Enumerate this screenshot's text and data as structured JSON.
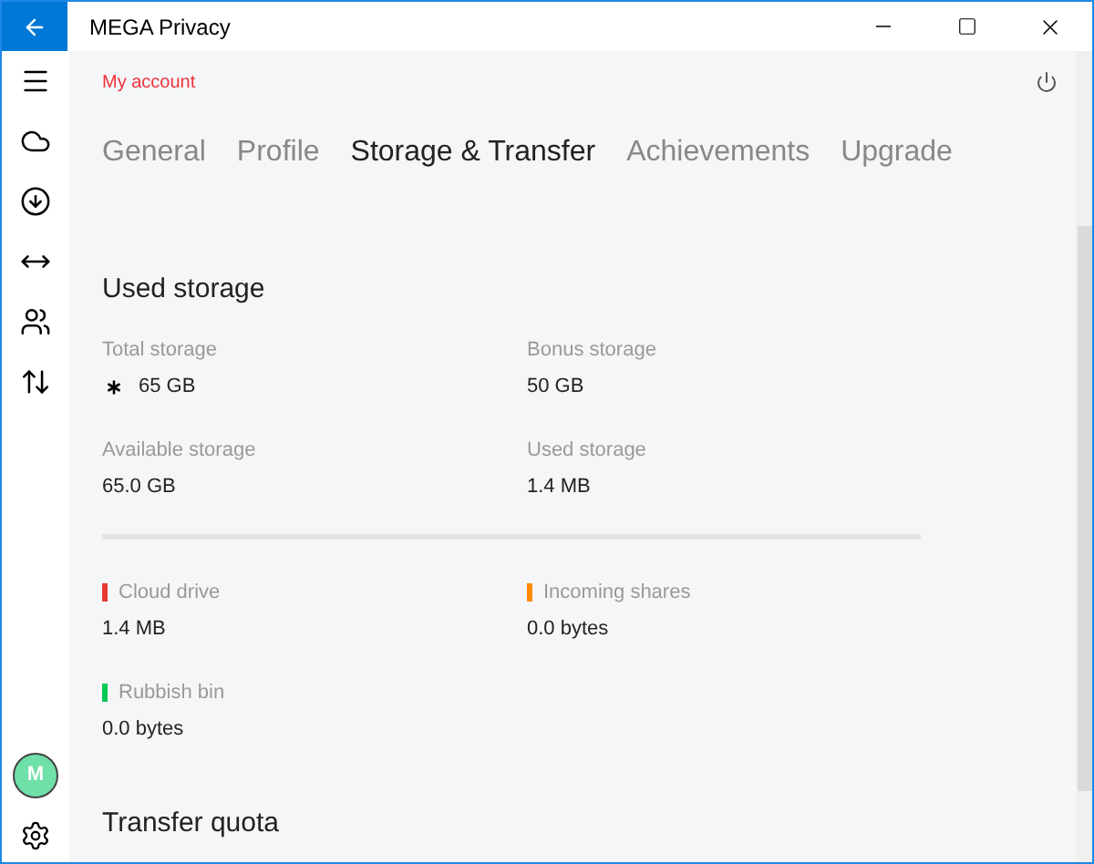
{
  "window": {
    "title": "MEGA Privacy"
  },
  "sidebar": {
    "items": [
      {
        "kind": "menu"
      },
      {
        "kind": "cloud"
      },
      {
        "kind": "download"
      },
      {
        "kind": "transfer"
      },
      {
        "kind": "contacts"
      },
      {
        "kind": "updown"
      }
    ],
    "avatar": "M"
  },
  "header": {
    "breadcrumb": "My account"
  },
  "tabs": [
    {
      "label": "General",
      "selected": false
    },
    {
      "label": "Profile",
      "selected": false
    },
    {
      "label": "Storage & Transfer",
      "selected": true
    },
    {
      "label": "Achievements",
      "selected": false
    },
    {
      "label": "Upgrade",
      "selected": false
    }
  ],
  "used_storage": {
    "title": "Used storage",
    "stats": [
      {
        "label": "Total storage",
        "value": "65 GB",
        "asterisk": true
      },
      {
        "label": "Bonus storage",
        "value": "50 GB",
        "asterisk": false
      },
      {
        "label": "Available storage",
        "value": "65.0 GB",
        "asterisk": false
      },
      {
        "label": "Used storage",
        "value": "1.4 MB",
        "asterisk": false
      }
    ],
    "breakdown": [
      {
        "label": "Cloud drive",
        "value": "1.4 MB",
        "color": "#e53935"
      },
      {
        "label": "Incoming shares",
        "value": "0.0 bytes",
        "color": "#ff8a00"
      },
      {
        "label": "Rubbish bin",
        "value": "0.0 bytes",
        "color": "#00c853"
      }
    ]
  },
  "transfer_quota": {
    "title": "Transfer quota"
  }
}
